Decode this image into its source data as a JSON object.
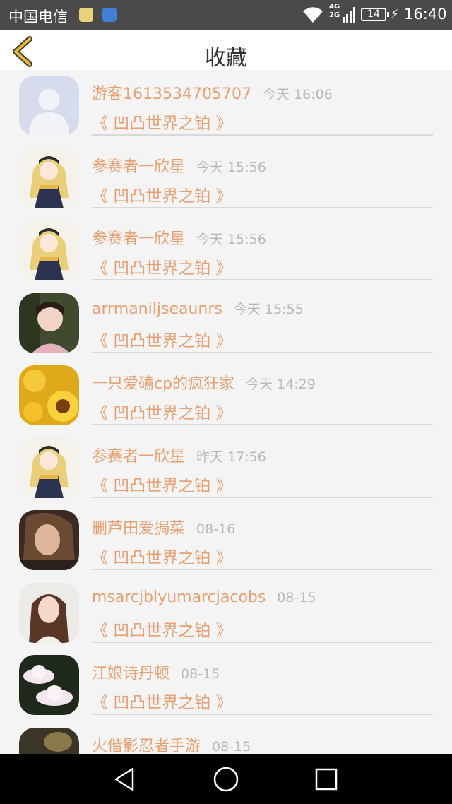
{
  "status_bar": {
    "carrier": "中国电信",
    "network_top": "4G",
    "network_bottom": "2G",
    "battery": "14",
    "time": "16:40"
  },
  "header": {
    "title": "收藏"
  },
  "favorites": [
    {
      "name": "游客1613534705707",
      "time": "今天 16:06",
      "book": "《 凹凸世界之铂 》",
      "avatar": "default-avatar-icon"
    },
    {
      "name": "参赛者一欣星",
      "time": "今天 15:56",
      "book": "《 凹凸世界之铂 》",
      "avatar": "anime-girl-avatar"
    },
    {
      "name": "参赛者一欣星",
      "time": "今天 15:56",
      "book": "《 凹凸世界之铂 》",
      "avatar": "anime-girl-avatar"
    },
    {
      "name": "arrmaniljseaunrs",
      "time": "今天 15:55",
      "book": "《 凹凸世界之铂 》",
      "avatar": "photo-girl-avatar"
    },
    {
      "name": "一只爱磕cp的疯狂家",
      "time": "今天 14:29",
      "book": "《 凹凸世界之铂 》",
      "avatar": "sunflower-avatar"
    },
    {
      "name": "参赛者一欣星",
      "time": "昨天 17:56",
      "book": "《 凹凸世界之铂 》",
      "avatar": "anime-girl-avatar"
    },
    {
      "name": "删芦田爱挶菜",
      "time": "08-16",
      "book": "《 凹凸世界之铂 》",
      "avatar": "woman-portrait-avatar"
    },
    {
      "name": "msarcjblyumarcjacobs",
      "time": "08-15",
      "book": "《 凹凸世界之铂 》",
      "avatar": "long-hair-girl-avatar"
    },
    {
      "name": "江娘诗丹顿",
      "time": "08-15",
      "book": "《 凹凸世界之铂 》",
      "avatar": "lotus-avatar"
    },
    {
      "name": "火偕影忍者手游",
      "time": "08-15",
      "book": "",
      "avatar": "dark-avatar"
    }
  ],
  "colors": {
    "accent": "#e7a071",
    "time_gray": "#b8b8b8",
    "back_arrow": "#e8b92c"
  }
}
